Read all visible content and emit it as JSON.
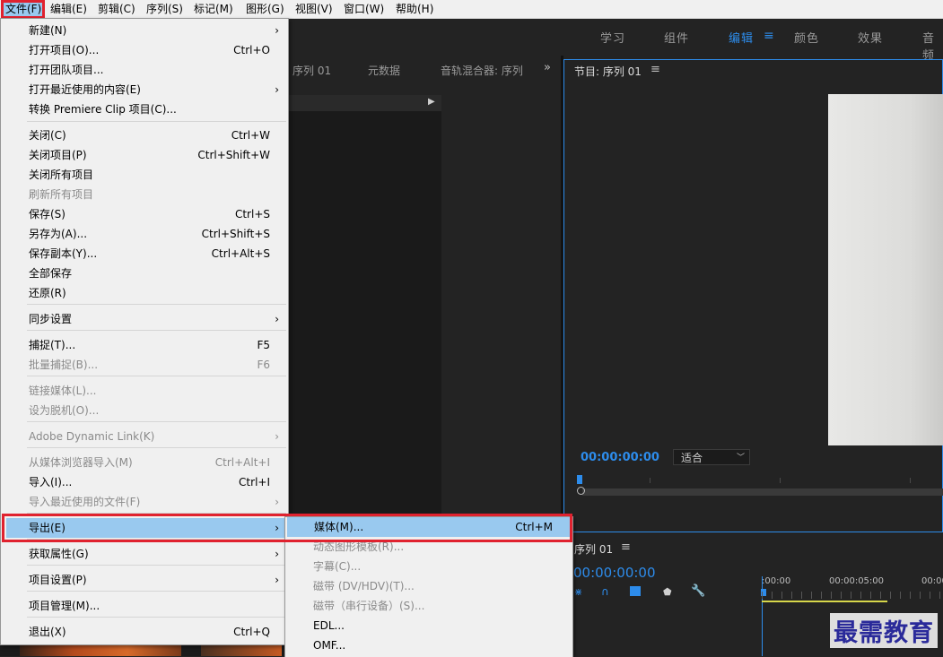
{
  "menubar": [
    "文件(F)",
    "编辑(E)",
    "剪辑(C)",
    "序列(S)",
    "标记(M)",
    "图形(G)",
    "视图(V)",
    "窗口(W)",
    "帮助(H)"
  ],
  "workspaces": [
    "学习",
    "组件",
    "编辑",
    "颜色",
    "效果",
    "音频"
  ],
  "workspace_active": "编辑",
  "source_panel": {
    "tabs": [
      "序列 01",
      "元数据",
      "音轨混合器: 序列"
    ]
  },
  "program_monitor": {
    "title": "节目: 序列 01",
    "timecode": "00:00:00:00",
    "fit": "适合"
  },
  "timeline": {
    "title": "序列 01",
    "timecode": "00:00:00:00",
    "ruler_labels": [
      ":00:00",
      "00:00:05:00",
      "00:00"
    ]
  },
  "file_menu": [
    {
      "label": "新建(N)",
      "submenu": true
    },
    {
      "label": "打开项目(O)...",
      "shortcut": "Ctrl+O"
    },
    {
      "label": "打开团队项目..."
    },
    {
      "label": "打开最近使用的内容(E)",
      "submenu": true
    },
    {
      "label": "转换 Premiere Clip 项目(C)..."
    },
    {
      "label": "关闭(C)",
      "shortcut": "Ctrl+W"
    },
    {
      "label": "关闭项目(P)",
      "shortcut": "Ctrl+Shift+W"
    },
    {
      "label": "关闭所有项目"
    },
    {
      "label": "刷新所有项目",
      "disabled": true
    },
    {
      "label": "保存(S)",
      "shortcut": "Ctrl+S"
    },
    {
      "label": "另存为(A)...",
      "shortcut": "Ctrl+Shift+S"
    },
    {
      "label": "保存副本(Y)...",
      "shortcut": "Ctrl+Alt+S"
    },
    {
      "label": "全部保存"
    },
    {
      "label": "还原(R)"
    },
    {
      "label": "同步设置",
      "submenu": true
    },
    {
      "label": "捕捉(T)...",
      "shortcut": "F5"
    },
    {
      "label": "批量捕捉(B)...",
      "shortcut": "F6",
      "disabled": true
    },
    {
      "label": "链接媒体(L)...",
      "disabled": true
    },
    {
      "label": "设为脱机(O)...",
      "disabled": true
    },
    {
      "label": "Adobe Dynamic Link(K)",
      "submenu": true,
      "disabled": true
    },
    {
      "label": "从媒体浏览器导入(M)",
      "shortcut": "Ctrl+Alt+I",
      "disabled": true
    },
    {
      "label": "导入(I)...",
      "shortcut": "Ctrl+I"
    },
    {
      "label": "导入最近使用的文件(F)",
      "submenu": true,
      "disabled": true
    },
    {
      "label": "导出(E)",
      "submenu": true,
      "highlighted": true
    },
    {
      "label": "获取属性(G)",
      "submenu": true
    },
    {
      "label": "项目设置(P)",
      "submenu": true
    },
    {
      "label": "项目管理(M)..."
    },
    {
      "label": "退出(X)",
      "shortcut": "Ctrl+Q"
    }
  ],
  "export_submenu": [
    {
      "label": "媒体(M)...",
      "shortcut": "Ctrl+M",
      "highlighted": true
    },
    {
      "label": "动态图形模板(R)...",
      "disabled": true
    },
    {
      "label": "字幕(C)...",
      "disabled": true
    },
    {
      "label": "磁带 (DV/HDV)(T)...",
      "disabled": true
    },
    {
      "label": "磁带（串行设备）(S)...",
      "disabled": true
    },
    {
      "label": "EDL..."
    },
    {
      "label": "OMF..."
    }
  ],
  "watermark": "最需教育",
  "colors": {
    "accent": "#2d8ceb",
    "menu_highlight": "#99c9ef",
    "callout_red": "#e0222f"
  }
}
